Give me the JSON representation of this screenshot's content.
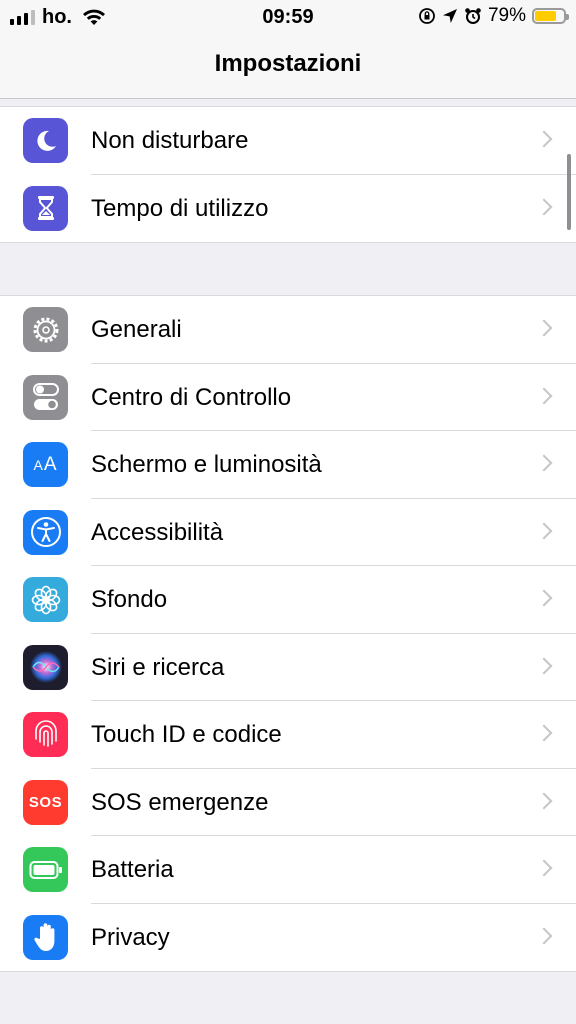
{
  "status_bar": {
    "carrier": "ho.",
    "time": "09:59",
    "battery_percent": "79%",
    "battery_level": 0.79,
    "battery_color": "#ffcc00"
  },
  "nav": {
    "title": "Impostazioni"
  },
  "groups": [
    {
      "items": [
        {
          "label": "Non disturbare",
          "icon": "moon-icon",
          "color": "#5856d6"
        },
        {
          "label": "Tempo di utilizzo",
          "icon": "hourglass-icon",
          "color": "#5856d6"
        }
      ]
    },
    {
      "items": [
        {
          "label": "Generali",
          "icon": "gear-icon",
          "color": "#8e8e93"
        },
        {
          "label": "Centro di Controllo",
          "icon": "toggles-icon",
          "color": "#8e8e93"
        },
        {
          "label": "Schermo e luminosità",
          "icon": "text-size-icon",
          "icon_text": "AA",
          "color": "#1a7cf5"
        },
        {
          "label": "Accessibilità",
          "icon": "accessibility-icon",
          "color": "#1a7cf5"
        },
        {
          "label": "Sfondo",
          "icon": "flower-icon",
          "color": "#35aadc"
        },
        {
          "label": "Siri e ricerca",
          "icon": "siri-icon",
          "color": "#1d1d2e"
        },
        {
          "label": "Touch ID e codice",
          "icon": "fingerprint-icon",
          "color": "#ff2d55"
        },
        {
          "label": "SOS emergenze",
          "icon": "sos-icon",
          "icon_text": "SOS",
          "color": "#ff3b30"
        },
        {
          "label": "Batteria",
          "icon": "battery-icon",
          "color": "#34c759"
        },
        {
          "label": "Privacy",
          "icon": "hand-icon",
          "color": "#1a7cf5"
        }
      ]
    }
  ]
}
